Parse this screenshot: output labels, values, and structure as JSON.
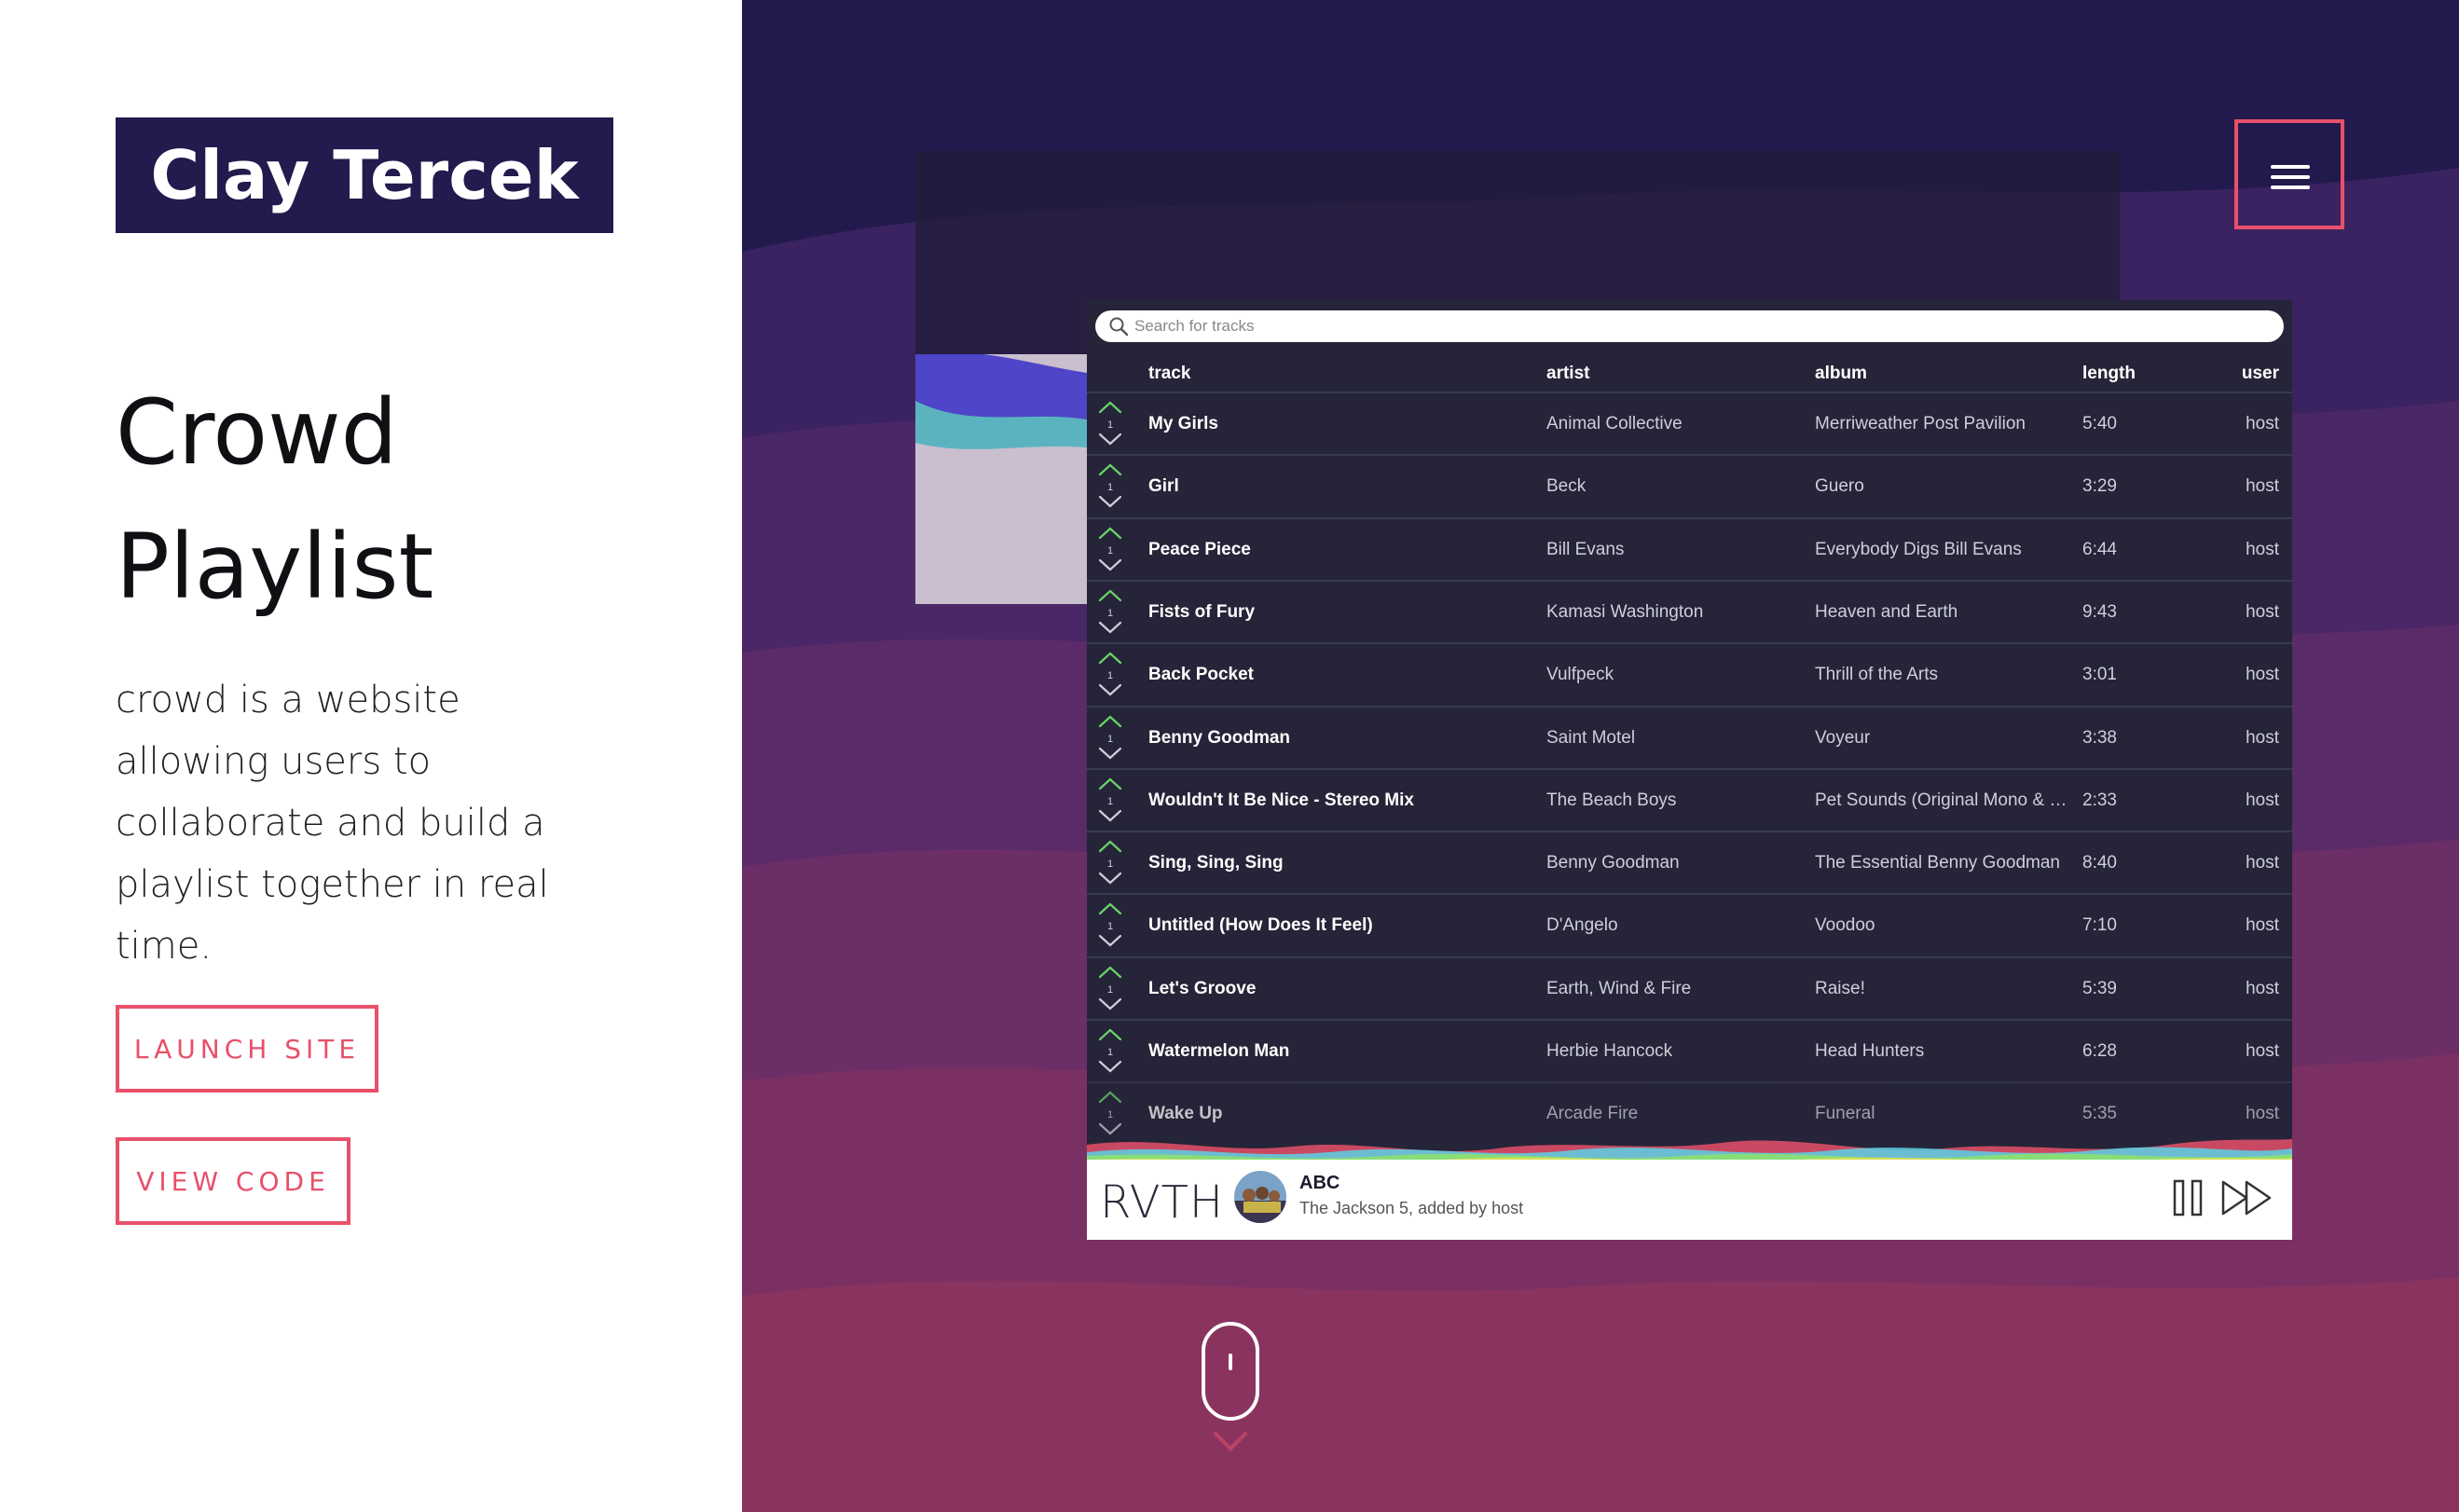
{
  "site": {
    "name": "Clay Tercek"
  },
  "project": {
    "title_line1": "Crowd",
    "title_line2": "Playlist",
    "description": "crowd is a website allowing users to collaborate and build a playlist together in real time.",
    "launch_label": "LAUNCH SITE",
    "code_label": "VIEW CODE"
  },
  "colors": {
    "accent": "#e8506a",
    "logo_bg": "#211b4e",
    "app_bg": "#252438"
  },
  "app": {
    "search_placeholder": "Search for tracks",
    "columns": {
      "track": "track",
      "artist": "artist",
      "album": "album",
      "length": "length",
      "user": "user"
    },
    "tracks": [
      {
        "votes": "1",
        "track": "My Girls",
        "artist": "Animal Collective",
        "album": "Merriweather Post Pavilion",
        "length": "5:40",
        "user": "host"
      },
      {
        "votes": "1",
        "track": "Girl",
        "artist": "Beck",
        "album": "Guero",
        "length": "3:29",
        "user": "host"
      },
      {
        "votes": "1",
        "track": "Peace Piece",
        "artist": "Bill Evans",
        "album": "Everybody Digs Bill Evans",
        "length": "6:44",
        "user": "host"
      },
      {
        "votes": "1",
        "track": "Fists of Fury",
        "artist": "Kamasi Washington",
        "album": "Heaven and Earth",
        "length": "9:43",
        "user": "host"
      },
      {
        "votes": "1",
        "track": "Back Pocket",
        "artist": "Vulfpeck",
        "album": "Thrill of the Arts",
        "length": "3:01",
        "user": "host"
      },
      {
        "votes": "1",
        "track": "Benny Goodman",
        "artist": "Saint Motel",
        "album": "Voyeur",
        "length": "3:38",
        "user": "host"
      },
      {
        "votes": "1",
        "track": "Wouldn't It Be Nice - Stereo Mix",
        "artist": "The Beach Boys",
        "album": "Pet Sounds (Original Mono & Ster...",
        "length": "2:33",
        "user": "host"
      },
      {
        "votes": "1",
        "track": "Sing, Sing, Sing",
        "artist": "Benny Goodman",
        "album": "The Essential Benny Goodman",
        "length": "8:40",
        "user": "host"
      },
      {
        "votes": "1",
        "track": "Untitled (How Does It Feel)",
        "artist": "D'Angelo",
        "album": "Voodoo",
        "length": "7:10",
        "user": "host"
      },
      {
        "votes": "1",
        "track": "Let's Groove",
        "artist": "Earth, Wind & Fire",
        "album": "Raise!",
        "length": "5:39",
        "user": "host"
      },
      {
        "votes": "1",
        "track": "Watermelon Man",
        "artist": "Herbie Hancock",
        "album": "Head Hunters",
        "length": "6:28",
        "user": "host"
      },
      {
        "votes": "1",
        "track": "Wake Up",
        "artist": "Arcade Fire",
        "album": "Funeral",
        "length": "5:35",
        "user": "host"
      }
    ],
    "player": {
      "brand": "RVTH",
      "now_playing_title": "ABC",
      "now_playing_meta": "The Jackson 5, added by host"
    }
  },
  "icons": {
    "menu": "hamburger-icon",
    "scroll": "mouse-scroll-icon",
    "upvote": "chevron-up-icon",
    "downvote": "chevron-down-icon",
    "pause": "pause-icon",
    "next": "skip-forward-icon",
    "search": "search-icon"
  }
}
